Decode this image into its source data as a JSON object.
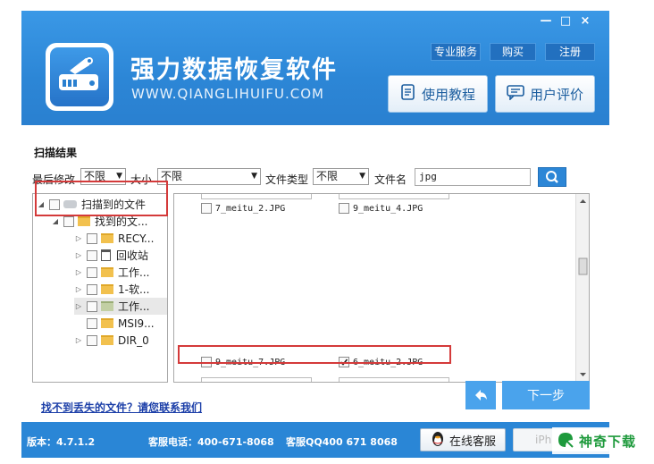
{
  "header": {
    "title": "强力数据恢复软件",
    "url": "WWW.QIANGLIHUIFU.COM",
    "window_controls": {
      "minimize": "—",
      "maximize": "□",
      "close": "×"
    },
    "top_links": [
      "专业服务",
      "购买",
      "注册"
    ],
    "tutorial_label": "使用教程",
    "review_label": "用户评价"
  },
  "filters": {
    "section_title": "扫描结果",
    "modified_label": "最后修改",
    "modified_value": "不限",
    "size_label": "大小",
    "size_value": "不限",
    "type_label": "文件类型",
    "type_value": "不限",
    "name_label": "文件名",
    "name_value": "jpg"
  },
  "tree": {
    "root": "扫描到的文件",
    "found": "找到的文...",
    "items": [
      "RECY...",
      "回收站",
      "工作...",
      "1-软...",
      "工作...",
      "MSI9...",
      "DIR_0"
    ]
  },
  "files": {
    "top": [
      {
        "name": "7_meitu_2.JPG",
        "checked": false
      },
      {
        "name": "9_meitu_4.JPG",
        "checked": false
      }
    ],
    "bottom": [
      {
        "name": "9_meitu_7.JPG",
        "checked": false
      },
      {
        "name": "6_meitu_2.JPG",
        "checked": true
      }
    ]
  },
  "contact_link": "找不到丢失的文件？请您联系我们",
  "next_label": "下一步",
  "footer": {
    "version": "版本：4.7.1.2",
    "phone": "客服电话：400-671-8068",
    "qq": "客服QQ400 671 8068",
    "online_service": "在线客服",
    "iphone": "iPh"
  },
  "watermark": "神奇下载",
  "colors": {
    "primary": "#2a86d6",
    "highlight": "#d43a3a",
    "watermark": "#1e9a3c"
  },
  "icons": {
    "logo": "hard-drive-wrench-icon",
    "tutorial": "document-icon",
    "review": "chat-icon",
    "search": "magnifier-icon",
    "back": "back-arrow-icon",
    "service": "qq-penguin-icon"
  }
}
